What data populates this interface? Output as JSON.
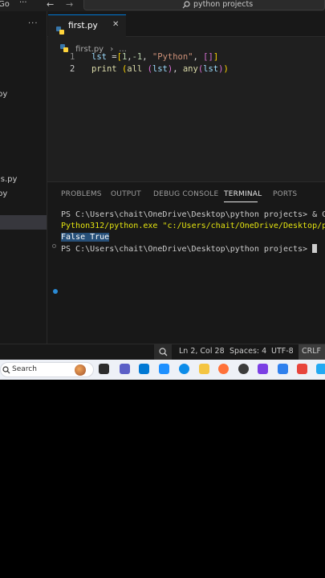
{
  "titlebar": {
    "left_fragment": "Go",
    "dots": "···",
    "search_text": "python projects"
  },
  "sidebar": {
    "header_dots": "···",
    "items": [
      {
        "label": "py"
      },
      {
        "label": "ls.py"
      },
      {
        "label": "py"
      }
    ]
  },
  "editor": {
    "tab_label": "first.py",
    "tab_close": "✕",
    "breadcrumb_file": "first.py",
    "breadcrumb_sep": "›",
    "breadcrumb_more": "...",
    "line_numbers": [
      "1",
      "2"
    ],
    "line1": {
      "a": "lst ",
      "b": "=",
      "c": "[",
      "d": "1",
      "e": ",",
      "f": "-1",
      "g": ", ",
      "h": "\"Python\"",
      "i": ", ",
      "j": "[]",
      "k": "]"
    },
    "line2": {
      "a": "print ",
      "b": "(",
      "c": "all ",
      "d": "(",
      "e": "lst",
      "f": ")",
      "g": ", ",
      "h": "any",
      "i": "(",
      "j": "lst",
      "k": ")",
      "l": ")"
    }
  },
  "panel": {
    "tabs": [
      "PROBLEMS",
      "OUTPUT",
      "DEBUG CONSOLE",
      "TERMINAL",
      "PORTS"
    ],
    "active_tab": "TERMINAL",
    "terminal_lines": [
      "PS C:\\Users\\chait\\OneDrive\\Desktop\\python projects> & C:/",
      "Python312/python.exe",
      " \"c:/Users/chait/OneDrive/Desktop/pyt",
      "False True",
      "PS C:\\Users\\chait\\OneDrive\\Desktop\\python projects> "
    ]
  },
  "statusbar": {
    "zoom_icon": "🔍",
    "position": "Ln 2, Col 28",
    "spaces": "Spaces: 4",
    "encoding": "UTF-8",
    "eol": "CRLF"
  },
  "taskbar": {
    "search_placeholder": "Search"
  },
  "colors": {
    "accent": "#0078d4",
    "editor_bg": "#1f1f1f",
    "panel_bg": "#181818"
  }
}
